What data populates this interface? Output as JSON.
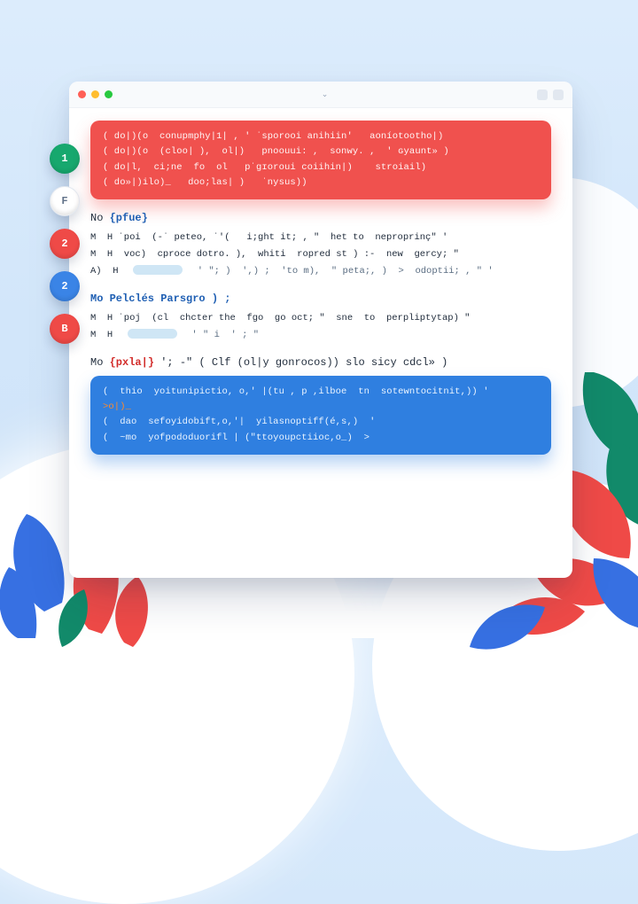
{
  "window": {
    "title": "",
    "titlebar_center": "⌄",
    "traffic_lights": [
      "close",
      "minimize",
      "zoom"
    ]
  },
  "gutter_badges": [
    {
      "label": "1",
      "variant": "green"
    },
    {
      "label": "F",
      "variant": "white"
    },
    {
      "label": "2",
      "variant": "red"
    },
    {
      "label": "2",
      "variant": "blue"
    },
    {
      "label": "B",
      "variant": "red"
    }
  ],
  "block_red_lines": [
    "( do|)(o  conupmphy|1| , ' ˈsporooi anihiin'   aoníotootho|)",
    "( do|)(o  (cloo| ),  ol|)   pnoouui: ,  sonwy. ,  ' ɢyaunt» )",
    "( do|l,  ci;ne  fo  ol   pˈɡɪoroui coiihin|)    stroiail)",
    "( do»|)ilo)_   doo;las| )   ˈnysus))"
  ],
  "section1": {
    "head_prefix": "No",
    "head_keyword": "{pfue}",
    "lines": [
      "M  H ˈpoi  (-ˈ peteo, ˈ'(   i;ght it; , \"  het to  neproprinç\" '",
      "M  H  voc)  cproce dotro. ),  whiti  ropred st ) :-  new  gercy; \"",
      "A)  H  ▮▮▮  ' \"; )  ',) ;  'to m),  \" peta;, )  >  odoptii; , \" '"
    ]
  },
  "section2": {
    "head": "Mo  Pelclés  Parsgro ) ;",
    "lines": [
      "M  H ˈpoj  (cl  chcter the  fgo  go oct; \"  sne  to  perpliptytap) \"",
      "M  H  ▮▮▮  ' \" i  ' ; \""
    ]
  },
  "section3": {
    "head_prefix": "Mo",
    "head_keyword": "{pxla|}",
    "head_tail": "'; -\" ( Clf  (ol|y   gonrocos))  slo  sicy  cdcl» )"
  },
  "block_blue_lines": [
    "(  thio  yoitunipictio, o,' |(tu , p ,ilboe  tn  sotewntocitnit,)) '",
    ">o|)_",
    "(  dao  sefoyidobift,o,'|  yilasnoptiff(é,s,)  '",
    "(  ~mo  yofpododuorifl | (\"ttoyoupctiioc,o_)  >"
  ],
  "colors": {
    "red": "#f0514e",
    "blue": "#2f7fe0",
    "green": "#17a86e"
  }
}
